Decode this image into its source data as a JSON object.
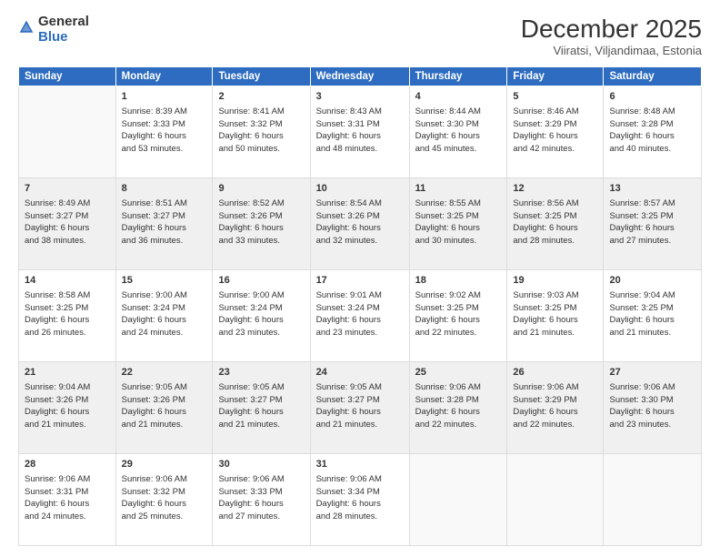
{
  "logo": {
    "text1": "General",
    "text2": "Blue"
  },
  "title": "December 2025",
  "subtitle": "Viiratsi, Viljandimaa, Estonia",
  "days_header": [
    "Sunday",
    "Monday",
    "Tuesday",
    "Wednesday",
    "Thursday",
    "Friday",
    "Saturday"
  ],
  "weeks": [
    [
      {
        "day": "",
        "info": ""
      },
      {
        "day": "1",
        "info": "Sunrise: 8:39 AM\nSunset: 3:33 PM\nDaylight: 6 hours\nand 53 minutes."
      },
      {
        "day": "2",
        "info": "Sunrise: 8:41 AM\nSunset: 3:32 PM\nDaylight: 6 hours\nand 50 minutes."
      },
      {
        "day": "3",
        "info": "Sunrise: 8:43 AM\nSunset: 3:31 PM\nDaylight: 6 hours\nand 48 minutes."
      },
      {
        "day": "4",
        "info": "Sunrise: 8:44 AM\nSunset: 3:30 PM\nDaylight: 6 hours\nand 45 minutes."
      },
      {
        "day": "5",
        "info": "Sunrise: 8:46 AM\nSunset: 3:29 PM\nDaylight: 6 hours\nand 42 minutes."
      },
      {
        "day": "6",
        "info": "Sunrise: 8:48 AM\nSunset: 3:28 PM\nDaylight: 6 hours\nand 40 minutes."
      }
    ],
    [
      {
        "day": "7",
        "info": "Sunrise: 8:49 AM\nSunset: 3:27 PM\nDaylight: 6 hours\nand 38 minutes."
      },
      {
        "day": "8",
        "info": "Sunrise: 8:51 AM\nSunset: 3:27 PM\nDaylight: 6 hours\nand 36 minutes."
      },
      {
        "day": "9",
        "info": "Sunrise: 8:52 AM\nSunset: 3:26 PM\nDaylight: 6 hours\nand 33 minutes."
      },
      {
        "day": "10",
        "info": "Sunrise: 8:54 AM\nSunset: 3:26 PM\nDaylight: 6 hours\nand 32 minutes."
      },
      {
        "day": "11",
        "info": "Sunrise: 8:55 AM\nSunset: 3:25 PM\nDaylight: 6 hours\nand 30 minutes."
      },
      {
        "day": "12",
        "info": "Sunrise: 8:56 AM\nSunset: 3:25 PM\nDaylight: 6 hours\nand 28 minutes."
      },
      {
        "day": "13",
        "info": "Sunrise: 8:57 AM\nSunset: 3:25 PM\nDaylight: 6 hours\nand 27 minutes."
      }
    ],
    [
      {
        "day": "14",
        "info": "Sunrise: 8:58 AM\nSunset: 3:25 PM\nDaylight: 6 hours\nand 26 minutes."
      },
      {
        "day": "15",
        "info": "Sunrise: 9:00 AM\nSunset: 3:24 PM\nDaylight: 6 hours\nand 24 minutes."
      },
      {
        "day": "16",
        "info": "Sunrise: 9:00 AM\nSunset: 3:24 PM\nDaylight: 6 hours\nand 23 minutes."
      },
      {
        "day": "17",
        "info": "Sunrise: 9:01 AM\nSunset: 3:24 PM\nDaylight: 6 hours\nand 23 minutes."
      },
      {
        "day": "18",
        "info": "Sunrise: 9:02 AM\nSunset: 3:25 PM\nDaylight: 6 hours\nand 22 minutes."
      },
      {
        "day": "19",
        "info": "Sunrise: 9:03 AM\nSunset: 3:25 PM\nDaylight: 6 hours\nand 21 minutes."
      },
      {
        "day": "20",
        "info": "Sunrise: 9:04 AM\nSunset: 3:25 PM\nDaylight: 6 hours\nand 21 minutes."
      }
    ],
    [
      {
        "day": "21",
        "info": "Sunrise: 9:04 AM\nSunset: 3:26 PM\nDaylight: 6 hours\nand 21 minutes."
      },
      {
        "day": "22",
        "info": "Sunrise: 9:05 AM\nSunset: 3:26 PM\nDaylight: 6 hours\nand 21 minutes."
      },
      {
        "day": "23",
        "info": "Sunrise: 9:05 AM\nSunset: 3:27 PM\nDaylight: 6 hours\nand 21 minutes."
      },
      {
        "day": "24",
        "info": "Sunrise: 9:05 AM\nSunset: 3:27 PM\nDaylight: 6 hours\nand 21 minutes."
      },
      {
        "day": "25",
        "info": "Sunrise: 9:06 AM\nSunset: 3:28 PM\nDaylight: 6 hours\nand 22 minutes."
      },
      {
        "day": "26",
        "info": "Sunrise: 9:06 AM\nSunset: 3:29 PM\nDaylight: 6 hours\nand 22 minutes."
      },
      {
        "day": "27",
        "info": "Sunrise: 9:06 AM\nSunset: 3:30 PM\nDaylight: 6 hours\nand 23 minutes."
      }
    ],
    [
      {
        "day": "28",
        "info": "Sunrise: 9:06 AM\nSunset: 3:31 PM\nDaylight: 6 hours\nand 24 minutes."
      },
      {
        "day": "29",
        "info": "Sunrise: 9:06 AM\nSunset: 3:32 PM\nDaylight: 6 hours\nand 25 minutes."
      },
      {
        "day": "30",
        "info": "Sunrise: 9:06 AM\nSunset: 3:33 PM\nDaylight: 6 hours\nand 27 minutes."
      },
      {
        "day": "31",
        "info": "Sunrise: 9:06 AM\nSunset: 3:34 PM\nDaylight: 6 hours\nand 28 minutes."
      },
      {
        "day": "",
        "info": ""
      },
      {
        "day": "",
        "info": ""
      },
      {
        "day": "",
        "info": ""
      }
    ]
  ]
}
